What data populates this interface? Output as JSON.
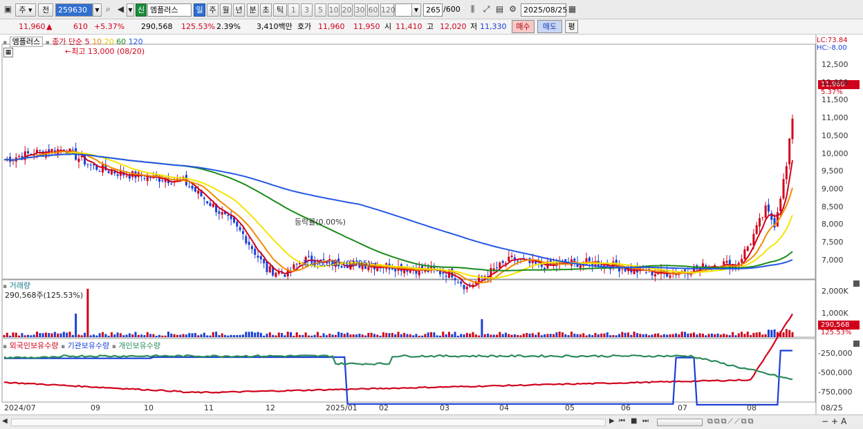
{
  "toolbar": {
    "market_label": "주",
    "scope_label": "전",
    "stock_code": "259630",
    "badge_new": "신",
    "stock_name": "엠플러스",
    "period_buttons": [
      "일",
      "주",
      "월",
      "년",
      "분",
      "초",
      "틱"
    ],
    "active_period": "일",
    "interval_buttons": [
      "1",
      "3",
      "5",
      "10",
      "20",
      "30",
      "60",
      "120"
    ],
    "count_display": "265",
    "count_max": "/600",
    "date": "2025/08/25"
  },
  "quote": {
    "price": "11,960",
    "change_arrow": "▲",
    "change": "610",
    "change_pct": "+5.37%",
    "volume": "290,568",
    "volume_ratio": "125.53%",
    "turnover": "2.39%",
    "amount": "3,410백만",
    "bid_label": "호가",
    "ask1": "11,960",
    "bid1": "11,950",
    "open_label": "시",
    "open": "11,410",
    "high_label": "고",
    "high": "12,020",
    "low_label": "저",
    "low": "11,330",
    "buy_label": "매수",
    "sell_label": "매도",
    "eval_label": "평"
  },
  "price_panel": {
    "title": "엠플러스",
    "legend_prefix": "종가 단순",
    "ma_labels": [
      "5",
      "10",
      "20",
      "60",
      "120"
    ],
    "ma_colors": [
      "#d0021b",
      "#f08c00",
      "#f5e400",
      "#1a8a1a",
      "#2457e6"
    ],
    "lc_label": "LC:73.84",
    "hc_label": "HC:-8.00",
    "high_annotation": "최고 13,000 (08/20)",
    "low_annotation": "최저 6,880 (02/05)",
    "flat_annotation": "등락률(0.00%)",
    "current_price_tag": "11,960",
    "current_pct_tag": "5.37%",
    "y_ticks": [
      "12,500",
      "12,000",
      "11,500",
      "11,000",
      "10,500",
      "10,000",
      "9,500",
      "9,000",
      "8,500",
      "8,000",
      "7,500",
      "7,000"
    ]
  },
  "volume_panel": {
    "title": "거래량",
    "value_label": "290,568주(125.53%)",
    "y_ticks": [
      "2,000K",
      "1,000K"
    ],
    "current_tag": "290,568",
    "current_pct_tag": "125.53%"
  },
  "holding_panel": {
    "series_labels": [
      "외국인보유수량",
      "기관보유수량",
      "개인보유수량"
    ],
    "series_colors": [
      "#d0021b",
      "#1a3fd6",
      "#2a8a5a"
    ],
    "y_ticks": [
      "-250,000",
      "-500,000",
      "-750,000"
    ]
  },
  "x_axis": {
    "labels": [
      "2024/07",
      "09",
      "10",
      "11",
      "12",
      "2025/01",
      "02",
      "03",
      "04",
      "05",
      "06",
      "07",
      "08",
      "08/25"
    ]
  },
  "colors": {
    "up": "#d0021b",
    "down": "#1a3fd6",
    "ma5": "#d0021b",
    "ma10": "#f08c00",
    "ma20": "#f5e400",
    "ma60": "#1a8a1a",
    "ma120": "#2457e6"
  }
}
